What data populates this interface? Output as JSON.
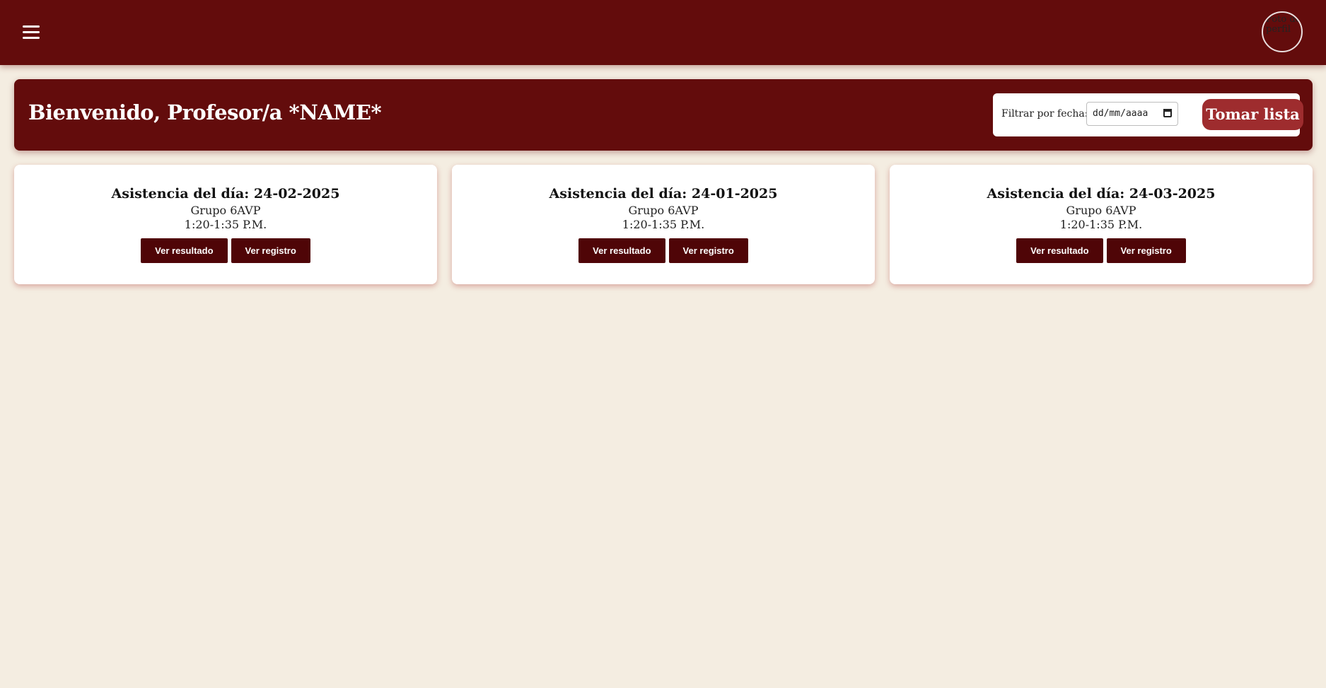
{
  "header": {
    "avatar_alt": "Foto de perfil"
  },
  "welcome": {
    "title": "Bienvenido, Profesor/a *NAME*",
    "filter_label": "Filtrar por fecha:",
    "date_placeholder": "dd/mm/aaaa",
    "take_list_button": "Tomar lista"
  },
  "cards": [
    {
      "title": "Asistencia del día: 24-02-2025",
      "group": "Grupo 6AVP",
      "time": "1:20-1:35 P.M.",
      "result_button": "Ver resultado",
      "record_button": "Ver registro"
    },
    {
      "title": "Asistencia del día: 24-01-2025",
      "group": "Grupo 6AVP",
      "time": "1:20-1:35 P.M.",
      "result_button": "Ver resultado",
      "record_button": "Ver registro"
    },
    {
      "title": "Asistencia del día: 24-03-2025",
      "group": "Grupo 6AVP",
      "time": "1:20-1:35 P.M.",
      "result_button": "Ver resultado",
      "record_button": "Ver registro"
    }
  ],
  "colors": {
    "primary": "#630c0c",
    "accent_button": "#9e2c2e",
    "card_button": "#4f0507",
    "background": "#f4ede1"
  }
}
